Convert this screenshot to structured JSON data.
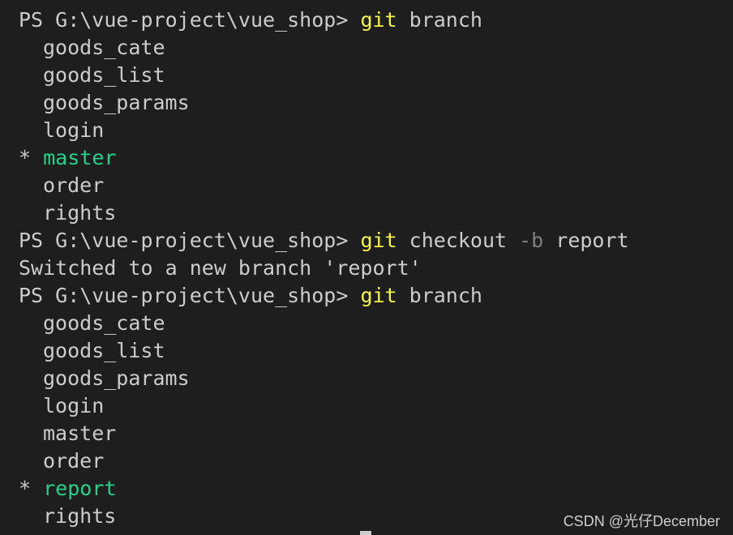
{
  "terminal": {
    "prompt": "PS G:\\vue-project\\vue_shop> ",
    "commands": [
      {
        "git": "git",
        "args": " branch"
      },
      {
        "git": "git",
        "args_pre": " checkout ",
        "flag": "-b",
        "args_post": " report"
      },
      {
        "git": "git",
        "args": " branch"
      }
    ],
    "branch_list_1": {
      "before": [
        "goods_cate",
        "goods_list",
        "goods_params",
        "login"
      ],
      "star": "* ",
      "current": "master",
      "after": [
        "order",
        "rights"
      ]
    },
    "switched_message": "Switched to a new branch 'report'",
    "branch_list_2": {
      "before": [
        "goods_cate",
        "goods_list",
        "goods_params",
        "login",
        "master",
        "order"
      ],
      "star": "* ",
      "current": "report",
      "after": [
        "rights"
      ]
    }
  },
  "watermark": "CSDN @光仔December",
  "colors": {
    "background": "#1e1e1e",
    "text": "#cccccc",
    "git_command": "#f5f543",
    "current_branch": "#23d18b",
    "flag": "#808080"
  }
}
